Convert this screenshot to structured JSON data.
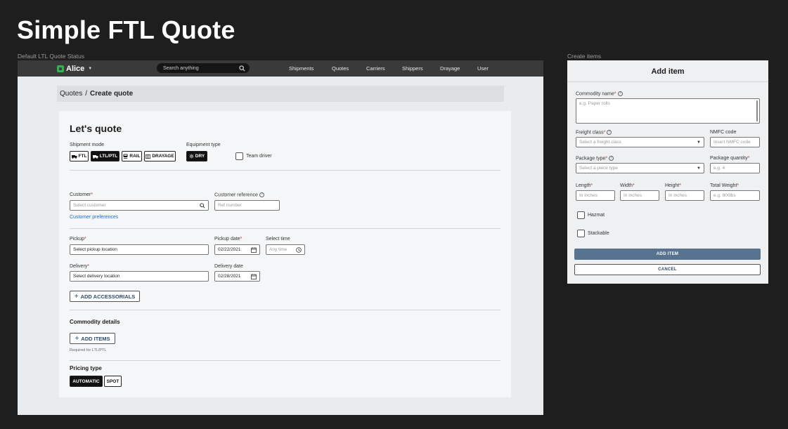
{
  "page": {
    "title": "Simple FTL Quote",
    "left_frame_label": "Default LTL Quote Status",
    "right_frame_label": "Create items"
  },
  "app": {
    "brand": "Alice",
    "search_placeholder": "Search anything",
    "nav": [
      "Shipments",
      "Quotes",
      "Carriers",
      "Shippers",
      "Drayage",
      "User"
    ]
  },
  "breadcrumb": {
    "parent": "Quotes",
    "separator": "/",
    "current": "Create quote"
  },
  "quote_form": {
    "heading": "Let's quote",
    "shipment_mode": {
      "label": "Shipment mode",
      "options": [
        {
          "label": "FTL",
          "icon": "truck-icon",
          "selected": false
        },
        {
          "label": "LTL/PTL",
          "icon": "truck-icon",
          "selected": true
        },
        {
          "label": "RAIL",
          "icon": "train-icon",
          "selected": false
        },
        {
          "label": "DRAYAGE",
          "icon": "container-icon",
          "selected": false
        }
      ]
    },
    "equipment_type": {
      "label": "Equipment type",
      "value": "DRY",
      "icon": "sun-icon"
    },
    "team_driver": {
      "label": "Team driver",
      "checked": false
    },
    "customer": {
      "label": "Customer",
      "required": "*",
      "placeholder": "Select customer"
    },
    "customer_reference": {
      "label": "Customer reference",
      "placeholder": "Ref number"
    },
    "customer_preferences_link": "Customer preferences",
    "pickup": {
      "label": "Pickup",
      "required": "*",
      "placeholder": "Select pickup location"
    },
    "pickup_date": {
      "label": "Pickup date",
      "required": "*",
      "value": "02/22/2021"
    },
    "select_time": {
      "label": "Select time",
      "placeholder": "Any time"
    },
    "delivery": {
      "label": "Delivery",
      "required": "*",
      "placeholder": "Select delivery location"
    },
    "delivery_date": {
      "label": "Delivery date",
      "value": "02/28/2021"
    },
    "add_accessorials": "ADD ACCESSORIALS",
    "commodity_details": "Commodity details",
    "add_items": "ADD ITEMS",
    "required_note": "Required for LTL/PTL",
    "pricing_type": {
      "label": "Pricing type",
      "options": [
        {
          "label": "AUTOMATIC",
          "selected": true
        },
        {
          "label": "SPOT",
          "selected": false
        }
      ]
    }
  },
  "add_item_modal": {
    "title": "Add item",
    "commodity_name": {
      "label": "Commodity name",
      "required": "*",
      "placeholder": "e.g. Paper rolls"
    },
    "freight_class": {
      "label": "Freight class",
      "required": "*",
      "placeholder": "Select a freight class"
    },
    "nmfc_code": {
      "label": "NMFC code",
      "placeholder": "Insert NMFC code"
    },
    "package_type": {
      "label": "Package type",
      "required": "*",
      "placeholder": "Select a piece type"
    },
    "package_quantity": {
      "label": "Package quantity",
      "required": "*",
      "placeholder": "e.g. 4"
    },
    "length": {
      "label": "Length",
      "required": "*",
      "placeholder": "In inches"
    },
    "width": {
      "label": "Width",
      "required": "*",
      "placeholder": "In inches"
    },
    "height": {
      "label": "Height",
      "required": "*",
      "placeholder": "In inches"
    },
    "total_weight": {
      "label": "Total Weight",
      "required": "*",
      "placeholder": "e.g. 800lbs"
    },
    "hazmat": {
      "label": "Hazmat",
      "checked": false
    },
    "stackable": {
      "label": "Stackable",
      "checked": false
    },
    "add_item_button": "ADD ITEM",
    "cancel_button": "CANCEL"
  },
  "colors": {
    "background": "#1e1e1e",
    "topbar": "#3a3a3a",
    "brand_green": "#2fb34a",
    "link_blue": "#1a73c8",
    "primary_button": "#58738f",
    "required_red": "#c0392b"
  }
}
